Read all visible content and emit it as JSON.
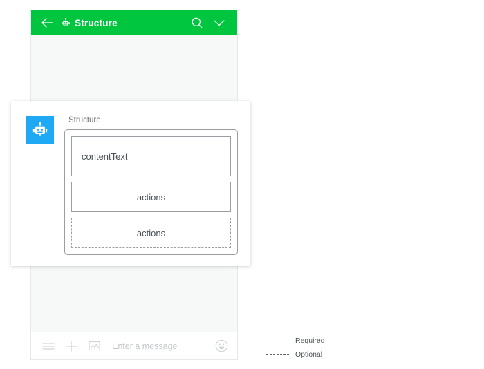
{
  "phone": {
    "header": {
      "back_icon": "arrow-left-icon",
      "bot_icon": "robot-icon",
      "title": "Structure",
      "search_icon": "search-icon",
      "chevron_icon": "chevron-down-icon"
    },
    "composer": {
      "menu_icon": "hamburger-menu-icon",
      "add_icon": "plus-icon",
      "image_icon": "image-icon",
      "placeholder": "Enter a message",
      "emoji_icon": "smiley-icon"
    }
  },
  "card": {
    "avatar_icon": "robot-avatar-icon",
    "bubble_label": "Structure",
    "slots": [
      {
        "label": "contentText",
        "style": "solid",
        "align": "left"
      },
      {
        "label": "actions",
        "style": "solid",
        "align": "center"
      },
      {
        "label": "actions",
        "style": "dashed",
        "align": "center"
      }
    ]
  },
  "legend": {
    "items": [
      {
        "label": "Required",
        "style": "solid"
      },
      {
        "label": "Optional",
        "style": "dashed"
      }
    ]
  },
  "colors": {
    "brand_green": "#00c63f",
    "avatar_blue": "#1fa8f3",
    "border_gray": "#9a9ea2",
    "phone_bg": "#f7f8f8"
  }
}
